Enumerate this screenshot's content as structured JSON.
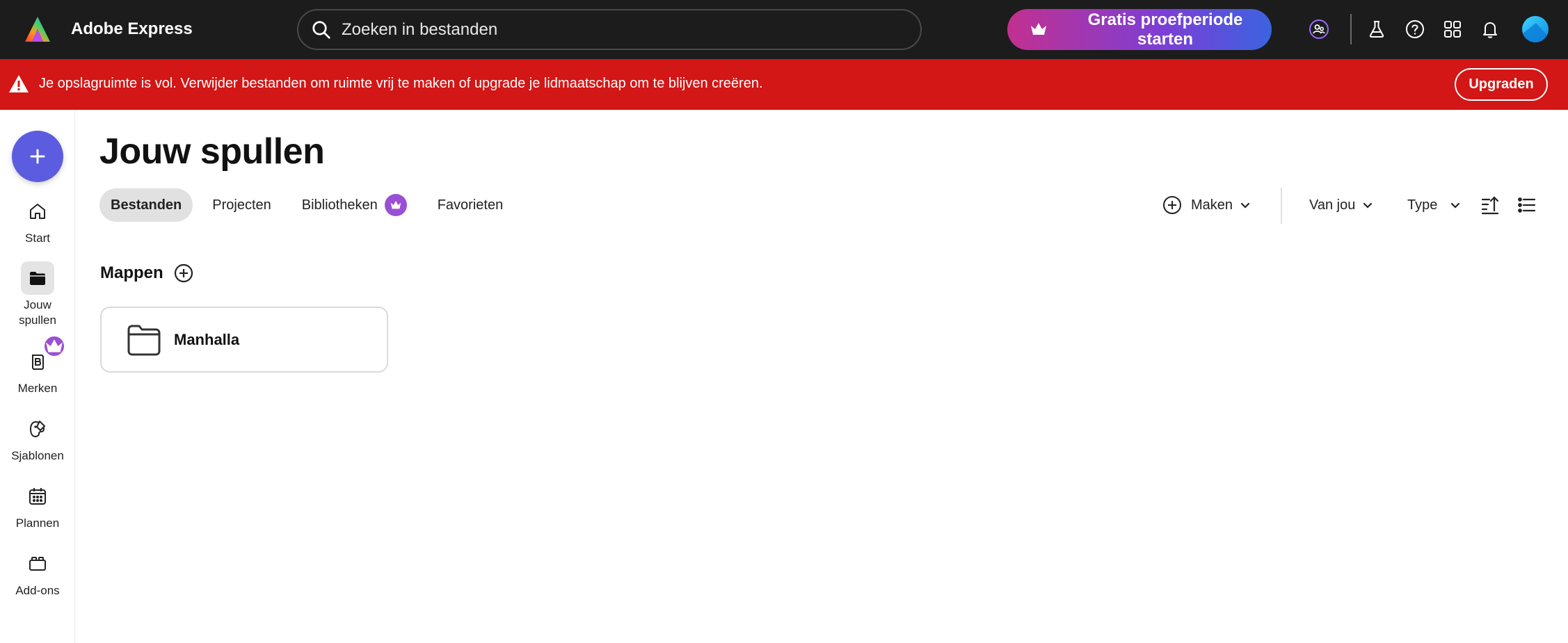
{
  "app": {
    "brand": "Adobe Express"
  },
  "search": {
    "placeholder": "Zoeken in bestanden"
  },
  "header": {
    "trial_label": "Gratis proefperiode starten"
  },
  "alert": {
    "message": "Je opslagruimte is vol. Verwijder bestanden om ruimte vrij te maken of upgrade je lidmaatschap om te blijven creëren.",
    "action_label": "Upgraden",
    "color": "#d31616"
  },
  "sidebar": {
    "items": [
      {
        "label": "Start",
        "icon": "home-icon"
      },
      {
        "label": "Jouw spullen",
        "icon": "folder-icon"
      },
      {
        "label": "Merken",
        "icon": "brand-icon"
      },
      {
        "label": "Sjablonen",
        "icon": "templates-icon"
      },
      {
        "label": "Plannen",
        "icon": "calendar-icon"
      },
      {
        "label": "Add-ons",
        "icon": "addons-icon"
      }
    ]
  },
  "main": {
    "title": "Jouw spullen",
    "tabs": [
      {
        "label": "Bestanden",
        "active": true
      },
      {
        "label": "Projecten"
      },
      {
        "label": "Bibliotheken",
        "premium": true
      },
      {
        "label": "Favorieten"
      }
    ],
    "toolbar": {
      "create_label": "Maken",
      "owner_label": "Van jou",
      "type_label": "Type"
    },
    "folders_section": {
      "title": "Mappen"
    },
    "folders": [
      {
        "name": "Manhalla"
      }
    ]
  },
  "colors": {
    "accent": "#5c5ce0",
    "premium": "#9b4fd4",
    "topbar": "#1c1c1c"
  }
}
